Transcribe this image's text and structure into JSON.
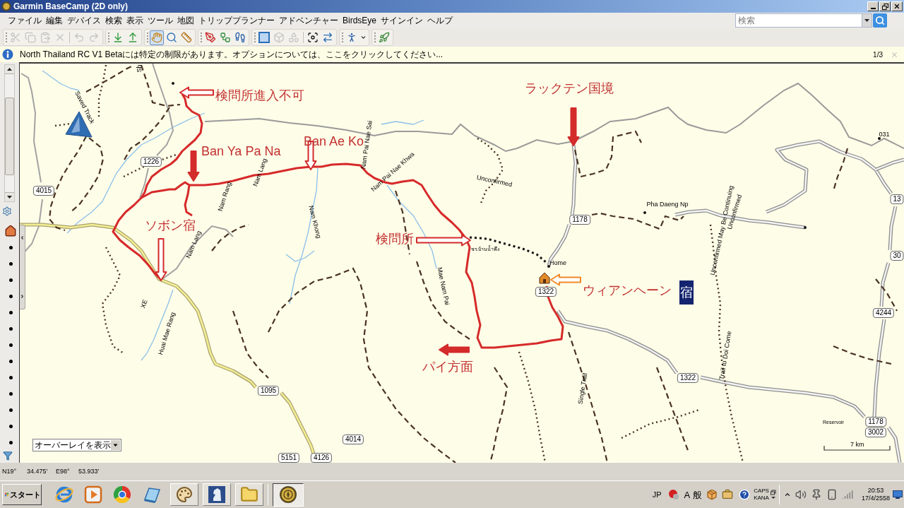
{
  "window": {
    "title": "Garmin BaseCamp (2D only)"
  },
  "menu": [
    "ファイル",
    "編集",
    "デバイス",
    "検索",
    "表示",
    "ツール",
    "地図",
    "トリッププランナー",
    "アドベンチャー",
    "BirdsEye",
    "サインイン",
    "ヘルプ"
  ],
  "search": {
    "placeholder": "検索"
  },
  "toolbar": [
    {
      "disabled": true,
      "selected": false
    },
    {
      "disabled": true,
      "selected": false
    },
    {
      "disabled": true,
      "selected": false
    },
    {
      "disabled": true,
      "selected": false
    },
    {
      "disabled": true,
      "selected": false
    },
    {
      "disabled": true,
      "selected": false
    },
    {
      "disabled": false,
      "selected": false
    },
    {
      "disabled": false,
      "selected": false
    },
    {
      "disabled": false,
      "selected": true
    },
    {
      "disabled": false,
      "selected": false
    },
    {
      "disabled": false,
      "selected": false
    },
    {
      "disabled": false,
      "selected": false
    },
    {
      "disabled": false,
      "selected": false
    },
    {
      "disabled": false,
      "selected": false
    },
    {
      "disabled": false,
      "selected": false
    },
    {
      "disabled": true,
      "selected": false
    },
    {
      "disabled": true,
      "selected": false
    },
    {
      "disabled": false,
      "selected": false
    },
    {
      "disabled": false,
      "selected": false
    },
    {
      "disabled": false,
      "selected": false
    },
    {
      "disabled": false,
      "selected": false
    },
    {
      "disabled": false,
      "selected": false
    }
  ],
  "notice": {
    "text": "North Thailand RC V1 Betaには特定の制限があります。オプションについては、ここをクリックしてください...",
    "page": "1/3"
  },
  "map": {
    "annotations": [
      {
        "text": "検問所進入不可",
        "selected": false
      },
      {
        "text": "Ban Ya Pa Na",
        "selected": false
      },
      {
        "text": "Ban Ae Ko",
        "selected": false
      },
      {
        "text": "ラックテン国境",
        "selected": false
      },
      {
        "text": "ソボン宿",
        "selected": false
      },
      {
        "text": "検問所",
        "selected": false
      },
      {
        "text": "ウィアンヘーン",
        "selected": false
      },
      {
        "text": "宿",
        "selected": true
      },
      {
        "text": "パイ方面",
        "selected": false
      }
    ],
    "labels": [
      {
        "kind": "label",
        "text": "Sh"
      },
      {
        "kind": "label",
        "text": "Saved Track"
      },
      {
        "kind": "shield",
        "text": "1226"
      },
      {
        "kind": "shield",
        "text": "4015"
      },
      {
        "kind": "label",
        "text": "Nam Lang"
      },
      {
        "kind": "label",
        "text": "Nam Rang"
      },
      {
        "kind": "label",
        "text": "Nam Pai Nae Sai"
      },
      {
        "kind": "label",
        "text": "Nam Pai Nae Khwa"
      },
      {
        "kind": "label",
        "text": "Unconfirmed"
      },
      {
        "kind": "label",
        "text": "Nam Khong"
      },
      {
        "kind": "label",
        "text": "Nam Lang"
      },
      {
        "kind": "label",
        "text": "Pha Daeng Np"
      },
      {
        "kind": "label",
        "text": "031"
      },
      {
        "kind": "label",
        "text": "Unconfirmed May Be Continuing"
      },
      {
        "kind": "label",
        "text": "Unconfirmed"
      },
      {
        "kind": "shield",
        "text": "13"
      },
      {
        "kind": "shield",
        "text": "1178"
      },
      {
        "kind": "minor",
        "text": "ชร.บ้านน้ำพึง"
      },
      {
        "kind": "shield",
        "text": "30"
      },
      {
        "kind": "label",
        "text": "Home"
      },
      {
        "kind": "label",
        "text": "Mae Nam Pai"
      },
      {
        "kind": "shield",
        "text": "1322"
      },
      {
        "kind": "label",
        "text": "XE"
      },
      {
        "kind": "label",
        "text": "Huai Mae Rang"
      },
      {
        "kind": "shield",
        "text": "4244"
      },
      {
        "kind": "label",
        "text": "Trail to Doi Come"
      },
      {
        "kind": "label",
        "text": "Single Trail"
      },
      {
        "kind": "shield",
        "text": "1322"
      },
      {
        "kind": "shield",
        "text": "1095"
      },
      {
        "kind": "minor",
        "text": "Reservoir"
      },
      {
        "kind": "shield",
        "text": "1178"
      },
      {
        "kind": "shield",
        "text": "3002"
      },
      {
        "kind": "shield",
        "text": "4014"
      },
      {
        "kind": "shield",
        "text": "5151"
      },
      {
        "kind": "shield",
        "text": "4126"
      }
    ],
    "overlay_select": {
      "value": "オーバーレイを表示"
    },
    "scale": "7 km"
  },
  "status_bar": {
    "latitude_degrees": "N19°",
    "latitude_minutes": "34.475'",
    "longitude_degrees": "E98°",
    "longitude_minutes": "53.933'"
  },
  "taskbar": {
    "start": "スタート",
    "language": "JP",
    "input_mode": [
      "A",
      "般"
    ],
    "keys": [
      "CAPS",
      "KANA"
    ],
    "time": "20:53",
    "date": "17/4/2558"
  }
}
